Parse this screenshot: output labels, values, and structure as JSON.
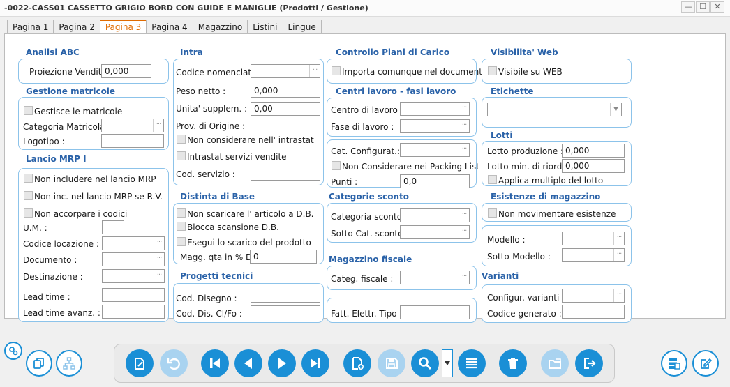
{
  "window": {
    "title": "-0022-CASS01 CASSETTO GRIGIO BORD CON GUIDE E MANIGLIE (Prodotti / Gestione)",
    "minimize": "—",
    "maximize": "☐",
    "close": "✕"
  },
  "tabs": [
    "Pagina 1",
    "Pagina 2",
    "Pagina 3",
    "Pagina 4",
    "Magazzino",
    "Listini",
    "Lingue"
  ],
  "active_tab": "Pagina 3",
  "analisi_abc": {
    "title": "Analisi ABC",
    "proiezione_label": "Proiezione Vendite",
    "proiezione_value": "0,000"
  },
  "gestione_matricole": {
    "title": "Gestione matricole",
    "gestisce_label": "Gestisce le matricole",
    "categoria_label": "Categoria Matricola :",
    "logotipo_label": "Logotipo :"
  },
  "lancio_mrp": {
    "title": "Lancio MRP I",
    "non_includere": "Non includere nel lancio MRP",
    "non_inc_rv": "Non inc. nel lancio MRP se R.V.",
    "non_accorpare": "Non accorpare i codici",
    "um_label": "U.M. :",
    "codice_locazione_label": "Codice locazione :",
    "documento_label": "Documento :",
    "destinazione_label": "Destinazione :",
    "lead_time_label": "Lead time :",
    "lead_time_avanz_label": "Lead time avanz. :"
  },
  "intra": {
    "title": "Intra",
    "codice_nomenclat_label": "Codice nomenclat. :",
    "peso_netto_label": "Peso netto :",
    "peso_netto_value": "0,000",
    "unita_supplem_label": "Unita' supplem. :",
    "unita_supplem_value": "0,00",
    "prov_origine_label": "Prov. di Origine :",
    "non_considerare_intrastat": "Non considerare nell' intrastat",
    "intrastat_servizi": "Intrastat servizi vendite",
    "cod_servizio_label": "Cod. servizio :"
  },
  "distinta_base": {
    "title": "Distinta di Base",
    "non_scaricare": "Non scaricare l' articolo a D.B.",
    "blocca_scansione": "Blocca scansione D.B.",
    "esegui_scarico": "Esegui lo scarico del prodotto",
    "magg_qta_label": "Magg. qta in % DB",
    "magg_qta_value": "0"
  },
  "progetti_tecnici": {
    "title": "Progetti tecnici",
    "cod_disegno_label": "Cod. Disegno :",
    "cod_dis_clfo_label": "Cod. Dis. Cl/Fo :"
  },
  "controllo_piani": {
    "title": "Controllo Piani di Carico",
    "importa_label": "Importa comunque nel documento"
  },
  "centri_lavoro": {
    "title": "Centri lavoro - fasi lavoro",
    "centro_label": "Centro di lavoro :",
    "fase_label": "Fase di lavoro :"
  },
  "configurat": {
    "cat_configurat_label": "Cat. Configurat.:",
    "non_considerare_packing": "Non Considerare nei Packing List",
    "punti_label": "Punti :",
    "punti_value": "0,0"
  },
  "categorie_sconto": {
    "title": "Categorie sconto",
    "categoria_label": "Categoria sconto :",
    "sotto_cat_label": "Sotto Cat. sconto :"
  },
  "magazzino_fiscale": {
    "title": "Magazzino fiscale",
    "categ_fiscale_label": "Categ. fiscale :",
    "fatt_elettr_label": "Fatt. Elettr. Tipo :"
  },
  "visibilita_web": {
    "title": "Visibilita' Web",
    "visibile_label": "Visibile su WEB"
  },
  "etichette": {
    "title": "Etichette"
  },
  "lotti": {
    "title": "Lotti",
    "lotto_produzione_label": "Lotto produzione :",
    "lotto_produzione_value": "0,000",
    "lotto_min_label": "Lotto min. di riord. :",
    "lotto_min_value": "0,000",
    "applica_multiplo": "Applica multiplo del lotto"
  },
  "esistenze_magazzino": {
    "title": "Esistenze di magazzino",
    "non_movimentare": "Non movimentare esistenze",
    "modello_label": "Modello :",
    "sotto_modello_label": "Sotto-Modello :"
  },
  "varianti": {
    "title": "Varianti",
    "configur_label": "Configur. varianti :",
    "codice_generato_label": "Codice generato :"
  },
  "lookup_glyph": "···",
  "dropdown_glyph": "▼",
  "colors": {
    "accent": "#1a8fd6",
    "section_title": "#2a62a8",
    "group_border": "#8cc3ea",
    "active_tab": "#e06b00"
  }
}
